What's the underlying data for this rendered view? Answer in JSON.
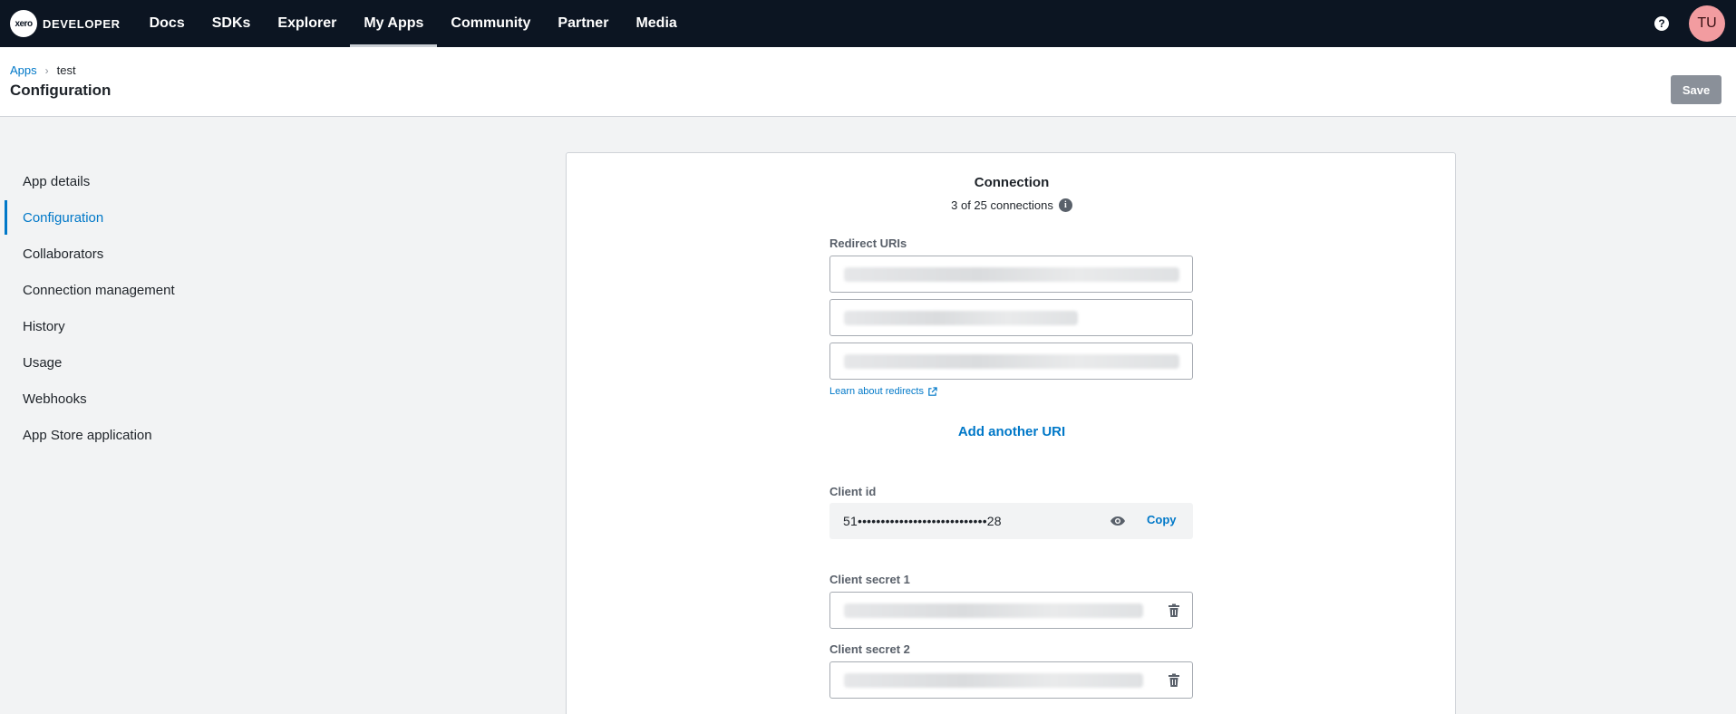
{
  "topnav": {
    "brand_logo_text": "xero",
    "brand_text": "DEVELOPER",
    "items": [
      {
        "label": "Docs"
      },
      {
        "label": "SDKs"
      },
      {
        "label": "Explorer"
      },
      {
        "label": "My Apps",
        "active": true
      },
      {
        "label": "Community"
      },
      {
        "label": "Partner"
      },
      {
        "label": "Media"
      }
    ],
    "help_icon": "question-circle-icon",
    "avatar_initials": "TU"
  },
  "header": {
    "breadcrumb": {
      "link": "Apps",
      "separator": "›",
      "current": "test"
    },
    "title": "Configuration",
    "save_label": "Save"
  },
  "sidebar": {
    "items": [
      {
        "label": "App details"
      },
      {
        "label": "Configuration",
        "active": true
      },
      {
        "label": "Collaborators"
      },
      {
        "label": "Connection management"
      },
      {
        "label": "History"
      },
      {
        "label": "Usage"
      },
      {
        "label": "Webhooks"
      },
      {
        "label": "App Store application"
      }
    ]
  },
  "connection": {
    "title": "Connection",
    "count_text": "3 of 25 connections",
    "info_icon": "i",
    "redirect_label": "Redirect URIs",
    "learn_link": "Learn about redirects",
    "add_uri": "Add another URI",
    "client_id_label": "Client id",
    "client_id_value": "51••••••••••••••••••••••••••••28",
    "copy_label": "Copy",
    "secret1_label": "Client secret 1",
    "secret2_label": "Client secret 2"
  },
  "colors": {
    "nav_bg": "#0c1522",
    "accent": "#0078c8",
    "avatar_bg": "#f29ca0",
    "save_bg": "#8a9099"
  }
}
